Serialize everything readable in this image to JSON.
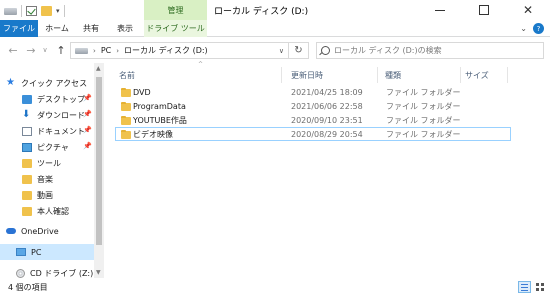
{
  "window": {
    "title": "ローカル ディスク (D:)",
    "context_tab_group": "管理"
  },
  "ribbon": {
    "tabs": [
      "ファイル",
      "ホーム",
      "共有",
      "表示",
      "ドライブ ツール"
    ],
    "file_tab_color": "#1979ca",
    "context_tab_color": "#d9f0c4",
    "help_icon": "?"
  },
  "address": {
    "crumbs": [
      "PC",
      "ローカル ディスク (D:)"
    ]
  },
  "search": {
    "placeholder": "ローカル ディスク (D:)の検索"
  },
  "sidebar": {
    "quick_access": "クイック アクセス",
    "items": [
      {
        "label": "デスクトップ",
        "icon": "desktop-icon",
        "pinned": true
      },
      {
        "label": "ダウンロード",
        "icon": "download-icon",
        "pinned": true
      },
      {
        "label": "ドキュメント",
        "icon": "document-icon",
        "pinned": true
      },
      {
        "label": "ピクチャ",
        "icon": "picture-icon",
        "pinned": true
      },
      {
        "label": "ツール",
        "icon": "folder-icon",
        "pinned": false
      },
      {
        "label": "音楽",
        "icon": "folder-icon",
        "pinned": false
      },
      {
        "label": "動画",
        "icon": "folder-icon",
        "pinned": false
      },
      {
        "label": "本人確認",
        "icon": "folder-icon",
        "pinned": false
      }
    ],
    "onedrive": "OneDrive",
    "pc": "PC",
    "cd_drive": "CD ドライブ (Z:) DVI"
  },
  "columns": {
    "name": "名前",
    "date": "更新日時",
    "type": "種類",
    "size": "サイズ"
  },
  "files": [
    {
      "name": "DVD",
      "date": "2021/04/25 18:09",
      "type": "ファイル フォルダー"
    },
    {
      "name": "ProgramData",
      "date": "2021/06/06 22:58",
      "type": "ファイル フォルダー"
    },
    {
      "name": "YOUTUBE作品",
      "date": "2020/09/10 23:51",
      "type": "ファイル フォルダー"
    },
    {
      "name": "ビデオ映像",
      "date": "2020/08/29 20:54",
      "type": "ファイル フォルダー"
    }
  ],
  "status": {
    "item_count": "4 個の項目"
  }
}
